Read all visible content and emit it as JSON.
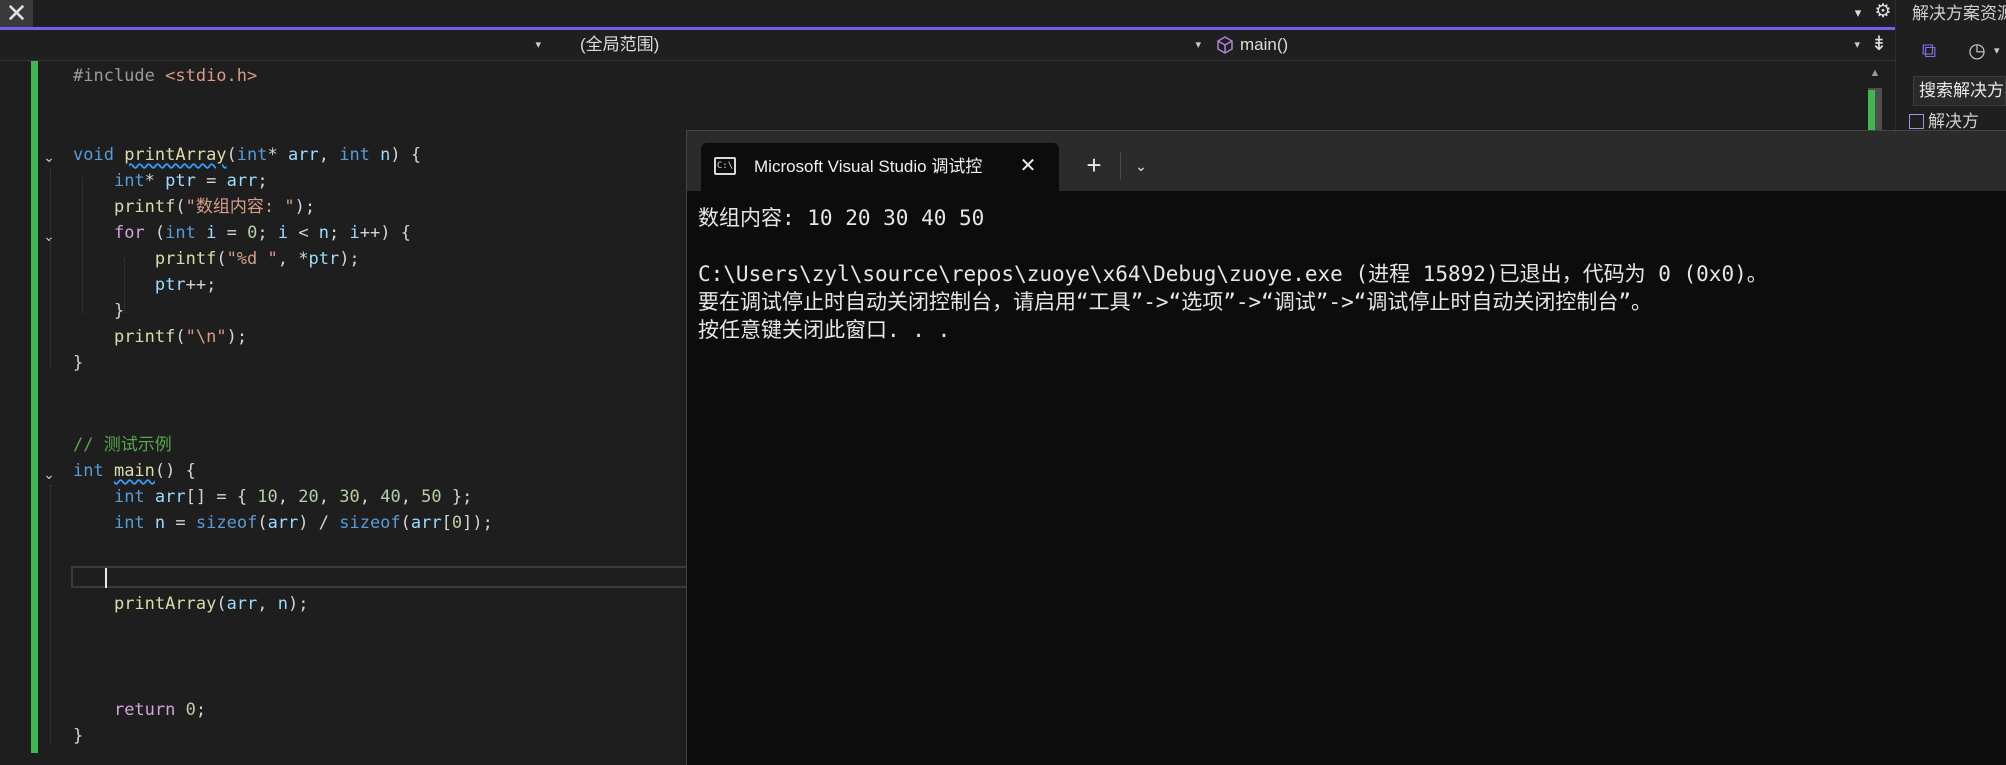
{
  "tabbar": {
    "close_label": "✕",
    "dropdown_glyph": "▾",
    "settings_glyph": "⚙"
  },
  "navbar": {
    "project": "",
    "scope": "(全局范围)",
    "member": "main()",
    "arrow": "▾",
    "split_glyph": "⇟"
  },
  "editor": {
    "lines": [
      {
        "t": "#include <stdio.h>"
      },
      {
        "t": ""
      },
      {
        "t": ""
      },
      {
        "t": "void printArray(int* arr, int n) {"
      },
      {
        "t": "    int* ptr = arr;"
      },
      {
        "t": "    printf(\"数组内容: \");"
      },
      {
        "t": "    for (int i = 0; i < n; i++) {"
      },
      {
        "t": "        printf(\"%d \", *ptr);"
      },
      {
        "t": "        ptr++;"
      },
      {
        "t": "    }"
      },
      {
        "t": "    printf(\"\\n\");"
      },
      {
        "t": "}"
      },
      {
        "t": ""
      },
      {
        "t": ""
      },
      {
        "t": "// 测试示例"
      },
      {
        "t": "int main() {"
      },
      {
        "t": "    int arr[] = { 10, 20, 30, 40, 50 };"
      },
      {
        "t": "    int n = sizeof(arr) / sizeof(arr[0]);"
      },
      {
        "t": ""
      },
      {
        "t": ""
      },
      {
        "t": "    printArray(arr, n);"
      },
      {
        "t": ""
      },
      {
        "t": ""
      },
      {
        "t": ""
      },
      {
        "t": "    return 0;"
      },
      {
        "t": "}"
      }
    ],
    "fold_glyph": "⌄"
  },
  "scrollbar": {
    "up_glyph": "▲"
  },
  "solution_explorer": {
    "title": "解决方案资源",
    "search_placeholder": "搜索解决方案",
    "item_label": "解决方",
    "history_glyph": "◷",
    "dropdown_glyph": "▾",
    "vs_glyph": "⧉"
  },
  "console": {
    "tab_title": "Microsoft Visual Studio 调试控",
    "icon_text": "C:\\",
    "close_glyph": "✕",
    "new_tab_glyph": "+",
    "menu_glyph": "⌄",
    "lines": [
      "数组内容: 10 20 30 40 50",
      "",
      "C:\\Users\\zyl\\source\\repos\\zuoye\\x64\\Debug\\zuoye.exe (进程 15892)已退出，代码为 0 (0x0)。",
      "要在调试停止时自动关闭控制台，请启用“工具”->“选项”->“调试”->“调试停止时自动关闭控制台”。",
      "按任意键关闭此窗口. . ."
    ]
  },
  "colors": {
    "accent": "#7160e8",
    "change_bar": "#3fb94f",
    "keyword": "#569cd6",
    "function": "#dcdcaa",
    "string": "#d69d85",
    "comment": "#57a64a"
  }
}
